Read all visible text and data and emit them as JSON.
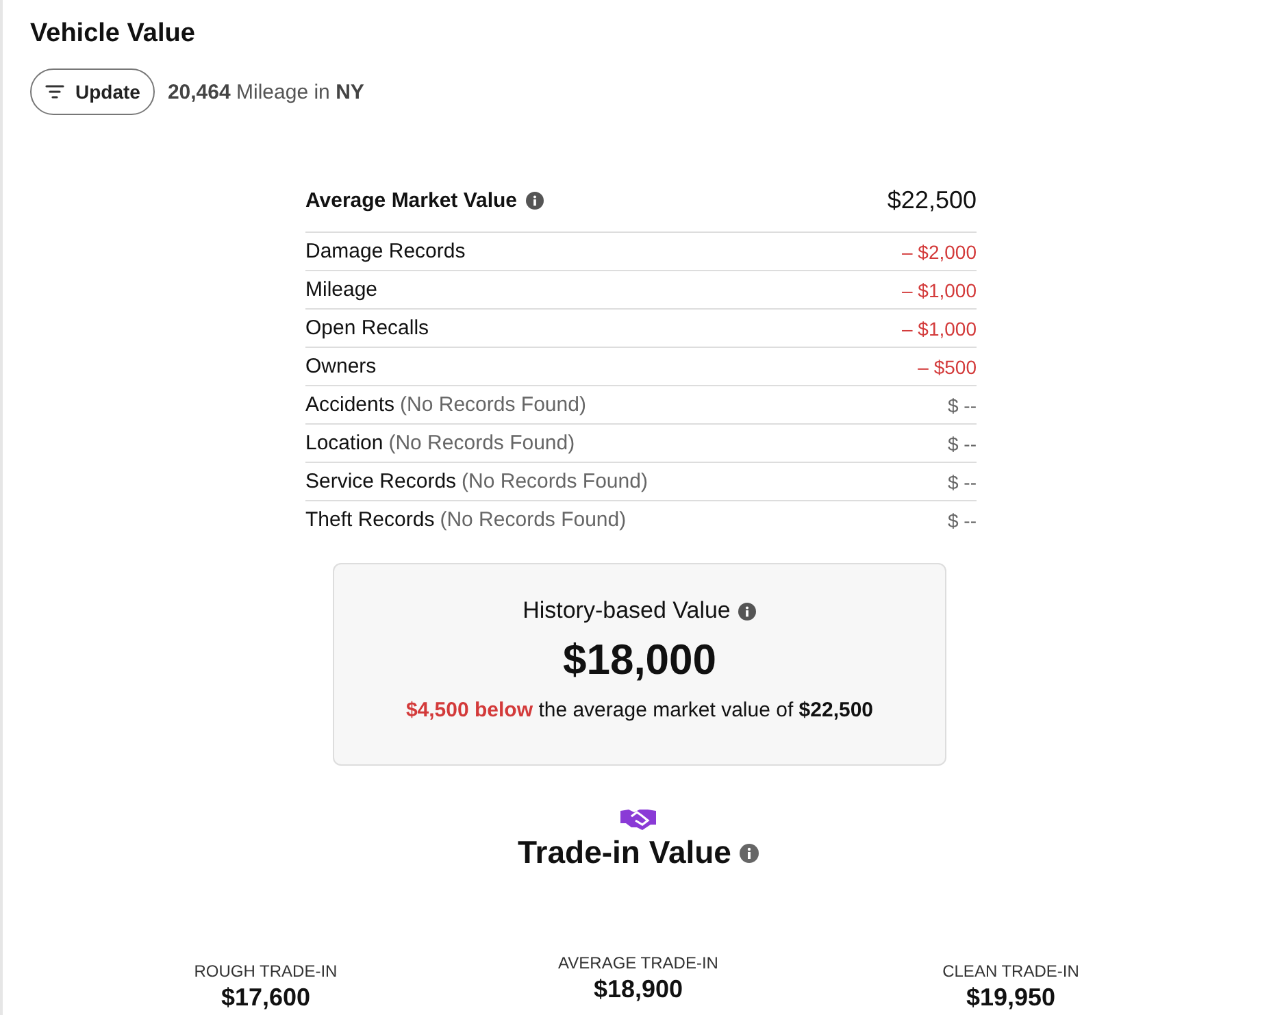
{
  "title": "Vehicle Value",
  "update_button": {
    "label": "Update"
  },
  "mileage": {
    "value": "20,464",
    "label": "Mileage in",
    "region": "NY"
  },
  "market": {
    "label": "Average Market Value",
    "value": "$22,500"
  },
  "adjustments": [
    {
      "label": "Damage Records",
      "amount": "– $2,000",
      "kind": "deduction"
    },
    {
      "label": "Mileage",
      "amount": "– $1,000",
      "kind": "deduction"
    },
    {
      "label": "Open Recalls",
      "amount": "– $1,000",
      "kind": "deduction"
    },
    {
      "label": "Owners",
      "amount": "– $500",
      "kind": "deduction"
    },
    {
      "label": "Accidents",
      "note": "(No Records Found)",
      "amount": "$ --",
      "kind": "none"
    },
    {
      "label": "Location",
      "note": "(No Records Found)",
      "amount": "$ --",
      "kind": "none"
    },
    {
      "label": "Service Records",
      "note": "(No Records Found)",
      "amount": "$ --",
      "kind": "none"
    },
    {
      "label": "Theft Records",
      "note": "(No Records Found)",
      "amount": "$ --",
      "kind": "none"
    }
  ],
  "history": {
    "label": "History-based Value",
    "value": "$18,000",
    "difference": "$4,500 below",
    "sentence": "the average market value of **$22,500**"
  },
  "trade_in": {
    "title": "Trade-in Value",
    "options": [
      {
        "label": "ROUGH TRADE-IN",
        "value": "$17,600"
      },
      {
        "label": "AVERAGE TRADE-IN",
        "value": "$18,900"
      },
      {
        "label": "CLEAN TRADE-IN",
        "value": "$19,950"
      }
    ]
  }
}
